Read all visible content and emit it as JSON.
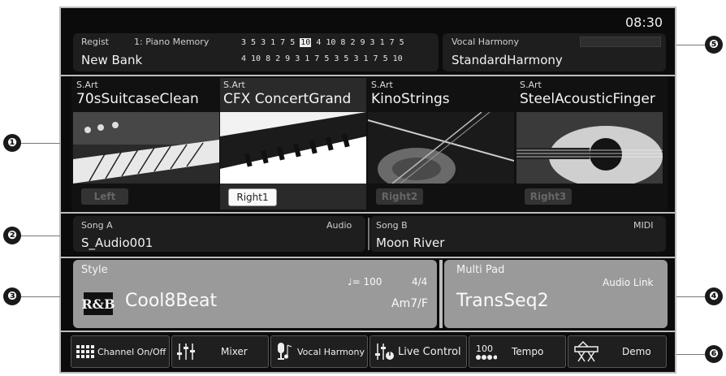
{
  "header": {
    "clock": "08:30"
  },
  "regist": {
    "label": "Regist",
    "bank_info": "1: Piano Memory",
    "bank_name": "New Bank",
    "row1_pre": "3 5 3 1 7 5 ",
    "row1_hl": "10",
    "row1_post": " 4 10 8 2 9 3 1 7 5",
    "row2": "4 10 8 2 9 3 1 7 5 3 5 3 1 7 5 10"
  },
  "vocal_harmony_panel": {
    "label": "Vocal Harmony",
    "value": "StandardHarmony"
  },
  "voices": [
    {
      "tag": "S.Art",
      "name": "70sSuitcaseClean",
      "part": "Left",
      "active": false,
      "icon": "electric-piano-photo"
    },
    {
      "tag": "S.Art",
      "name": "CFX ConcertGrand",
      "part": "Right1",
      "active": true,
      "icon": "grand-piano-photo"
    },
    {
      "tag": "S.Art",
      "name": "KinoStrings",
      "part": "Right2",
      "active": false,
      "icon": "violin-photo"
    },
    {
      "tag": "S.Art",
      "name": "SteelAcousticFinger",
      "part": "Right3",
      "active": false,
      "icon": "acoustic-guitar-photo"
    }
  ],
  "song_a": {
    "label": "Song A",
    "type": "Audio",
    "name": "S_Audio001"
  },
  "song_b": {
    "label": "Song B",
    "type": "MIDI",
    "name": "Moon River"
  },
  "style": {
    "label": "Style",
    "tempo": "♩= 100",
    "beat": "4/4",
    "chord": "Am7/F",
    "badge": "R&B",
    "name": "Cool8Beat"
  },
  "multipad": {
    "label": "Multi Pad",
    "link": "Audio Link",
    "name": "TransSeq2"
  },
  "buttons": [
    {
      "label": "Channel On/Off",
      "icon": "channel-grid-icon"
    },
    {
      "label": "Mixer",
      "icon": "mixer-sliders-icon"
    },
    {
      "label": "Vocal Harmony",
      "icon": "microphone-icon"
    },
    {
      "label": "Live Control",
      "icon": "live-control-knob-icon"
    },
    {
      "label": "Tempo",
      "value": "100",
      "icon": "tempo-dots-icon"
    },
    {
      "label": "Demo",
      "icon": "keyboard-stand-icon"
    }
  ],
  "callouts": [
    "❶",
    "❷",
    "❸",
    "❹",
    "❺",
    "❻"
  ],
  "colors": {
    "screen_bg": "#0b0b0b",
    "panel_bg": "#1e1e1e",
    "style_bg": "#9a9a9a",
    "highlight": "#fafafa"
  }
}
